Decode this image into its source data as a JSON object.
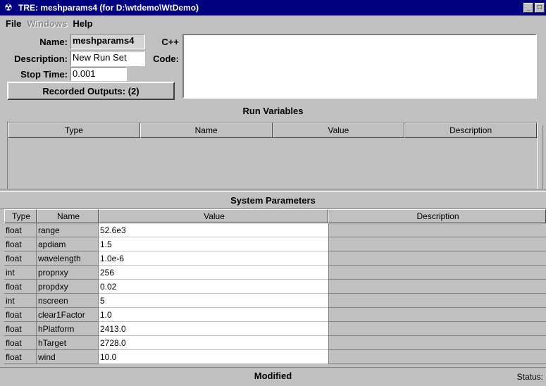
{
  "window": {
    "title": "TRE:  meshparams4  (for D:\\wtdemo\\WtDemo)",
    "minimize_glyph": "_",
    "maximize_glyph": "□"
  },
  "menu": {
    "file": "File",
    "windows": "Windows",
    "help": "Help"
  },
  "form": {
    "name_label": "Name:",
    "name_value": "meshparams4",
    "description_label": "Description:",
    "description_value": "New Run Set",
    "stop_time_label": "Stop Time:",
    "stop_time_value": "0.001",
    "recorded_outputs_label": "Recorded Outputs: (2)",
    "code_label_1": "C++",
    "code_label_2": "Code:",
    "code_value": ""
  },
  "run_variables": {
    "title": "Run Variables",
    "columns": [
      "Type",
      "Name",
      "Value",
      "Description"
    ]
  },
  "system_parameters": {
    "title": "System Parameters",
    "columns": [
      "Type",
      "Name",
      "Value",
      "Description"
    ],
    "rows": [
      {
        "type": "float",
        "name": "range",
        "value": "52.6e3",
        "description": ""
      },
      {
        "type": "float",
        "name": "apdiam",
        "value": "1.5",
        "description": ""
      },
      {
        "type": "float",
        "name": "wavelength",
        "value": "1.0e-6",
        "description": ""
      },
      {
        "type": "int",
        "name": "propnxy",
        "value": "256",
        "description": ""
      },
      {
        "type": "float",
        "name": "propdxy",
        "value": "0.02",
        "description": ""
      },
      {
        "type": "int",
        "name": "nscreen",
        "value": "5",
        "description": ""
      },
      {
        "type": "float",
        "name": "clear1Factor",
        "value": "1.0",
        "description": ""
      },
      {
        "type": "float",
        "name": "hPlatform",
        "value": "2413.0",
        "description": ""
      },
      {
        "type": "float",
        "name": "hTarget",
        "value": "2728.0",
        "description": ""
      },
      {
        "type": "float",
        "name": "wind",
        "value": "10.0",
        "description": ""
      }
    ]
  },
  "status": {
    "state": "Modified",
    "label": "Status:"
  }
}
